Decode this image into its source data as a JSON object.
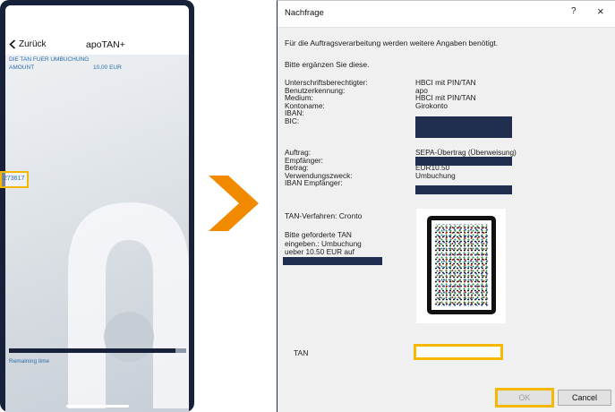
{
  "phone": {
    "back_label": "Zurück",
    "title": "apoTAN+",
    "tan_heading": "DIE TAN FUER UMBUCHUNG",
    "amount_label": "AMOUNT",
    "amount_value": "10,00 EUR",
    "tan_number": "273617",
    "remaining_label": "Remaining time",
    "remaining_progress": 0.94
  },
  "dialog": {
    "title": "Nachfrage",
    "help_label": "?",
    "close_label": "×",
    "intro_line1": "Für die Auftragsverarbeitung werden weitere Angaben benötigt.",
    "intro_line2": "Bitte ergänzen Sie diese.",
    "account": [
      {
        "key": "Unterschriftsberechtigter:",
        "value": "HBCI mit PIN/TAN"
      },
      {
        "key": "Benutzerkennung:",
        "value": "apo"
      },
      {
        "key": "Medium:",
        "value": "HBCI mit PIN/TAN"
      },
      {
        "key": "Kontoname:",
        "value": "Girokonto"
      },
      {
        "key": "IBAN:",
        "value": ""
      },
      {
        "key": "BIC:",
        "value": ""
      }
    ],
    "order": [
      {
        "key": "Auftrag:",
        "value": "SEPA-Übertrag (Überweisung)"
      },
      {
        "key": "Empfänger:",
        "value": ""
      },
      {
        "key": "Betrag:",
        "value": "EUR10.50"
      },
      {
        "key": "Verwendungszweck:",
        "value": "Umbuchung"
      },
      {
        "key": "IBAN Empfänger:",
        "value": ""
      }
    ],
    "tan_method": "TAN-Verfahren: Cronto",
    "prompt_line1": "Bitte geforderte TAN",
    "prompt_line2": "eingeben.: Umbuchung",
    "prompt_line3": "ueber 10.50 EUR auf",
    "tan_label": "TAN",
    "tan_value": "",
    "ok_label": "OK",
    "cancel_label": "Cancel"
  },
  "colors": {
    "accent_highlight": "#f5b800",
    "arrow": "#f28a00",
    "redaction": "#1f2d4f",
    "phone_frame": "#17223a",
    "info_text": "#2c6ea8"
  },
  "icons": {
    "back": "chevron-left-icon",
    "transition": "arrow-right-icon",
    "phone_logo": "apo-logo-icon",
    "cronto_code": "cronto-qr-icon"
  }
}
